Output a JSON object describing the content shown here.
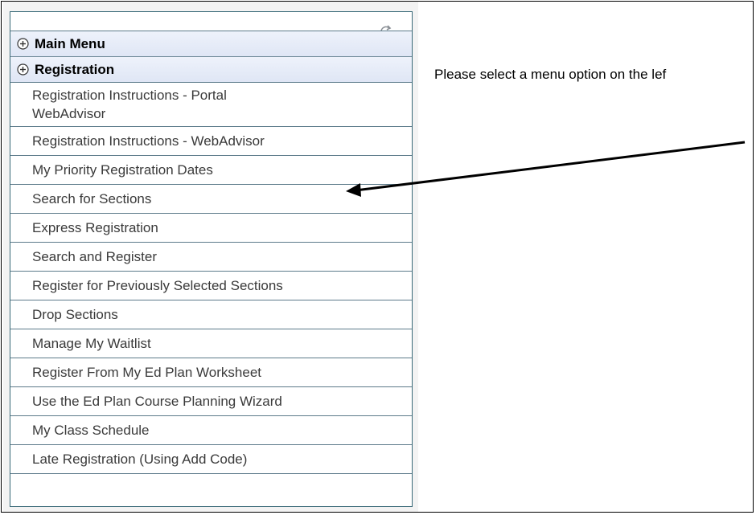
{
  "sidebar": {
    "refresh_icon": "refresh-icon",
    "headers": [
      {
        "label": "Main Menu",
        "icon": "plus-circle-icon"
      },
      {
        "label": "Registration",
        "icon": "plus-circle-icon"
      }
    ],
    "items": [
      {
        "label": "Registration Instructions - Portal WebAdvisor"
      },
      {
        "label": "Registration Instructions - WebAdvisor"
      },
      {
        "label": "My Priority Registration Dates"
      },
      {
        "label": "Search for Sections"
      },
      {
        "label": "Express Registration"
      },
      {
        "label": "Search and Register"
      },
      {
        "label": "Register for Previously Selected Sections"
      },
      {
        "label": "Drop Sections"
      },
      {
        "label": "Manage My Waitlist"
      },
      {
        "label": "Register From My Ed Plan Worksheet"
      },
      {
        "label": "Use the Ed Plan Course Planning Wizard"
      },
      {
        "label": "My Class Schedule"
      },
      {
        "label": "Late Registration (Using Add Code)"
      }
    ]
  },
  "main": {
    "message": "Please select a menu option on the lef"
  },
  "annotation": {
    "icon": "arrow-icon",
    "color": "#000000"
  }
}
